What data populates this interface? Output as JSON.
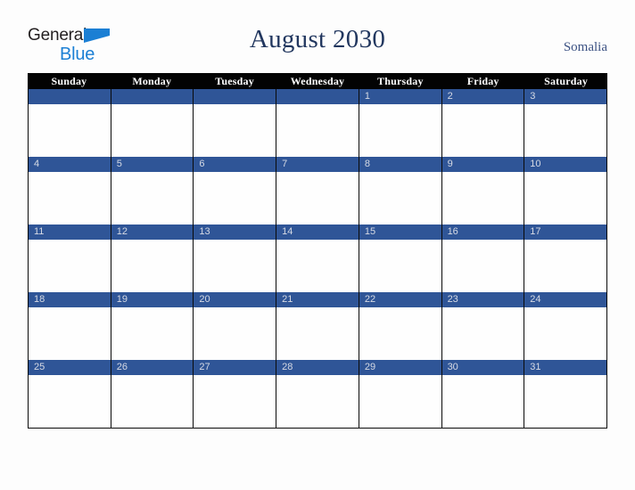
{
  "brand": {
    "logo_line1": "General",
    "logo_line2": "Blue",
    "triangle_icon": "blue-triangle-icon",
    "color_dark": "#231f20",
    "color_blue": "#1b7fd4"
  },
  "header": {
    "title": "August 2030",
    "region": "Somalia"
  },
  "calendar": {
    "month": "August",
    "year": "2030",
    "weekday_headers": [
      "Sunday",
      "Monday",
      "Tuesday",
      "Wednesday",
      "Thursday",
      "Friday",
      "Saturday"
    ],
    "colors": {
      "header_bg": "#030303",
      "header_text": "#ffffff",
      "day_band": "#2f5597",
      "day_number": "#d6dae4",
      "cell_bg": "#fefefe",
      "grid_line": "#0a0a0a",
      "title_text": "#22375f",
      "region_text": "#3c5283",
      "page_bg": "#fdfdfd"
    },
    "weeks": [
      [
        "",
        "",
        "",
        "",
        "1",
        "2",
        "3"
      ],
      [
        "4",
        "5",
        "6",
        "7",
        "8",
        "9",
        "10"
      ],
      [
        "11",
        "12",
        "13",
        "14",
        "15",
        "16",
        "17"
      ],
      [
        "18",
        "19",
        "20",
        "21",
        "22",
        "23",
        "24"
      ],
      [
        "25",
        "26",
        "27",
        "28",
        "29",
        "30",
        "31"
      ]
    ]
  }
}
